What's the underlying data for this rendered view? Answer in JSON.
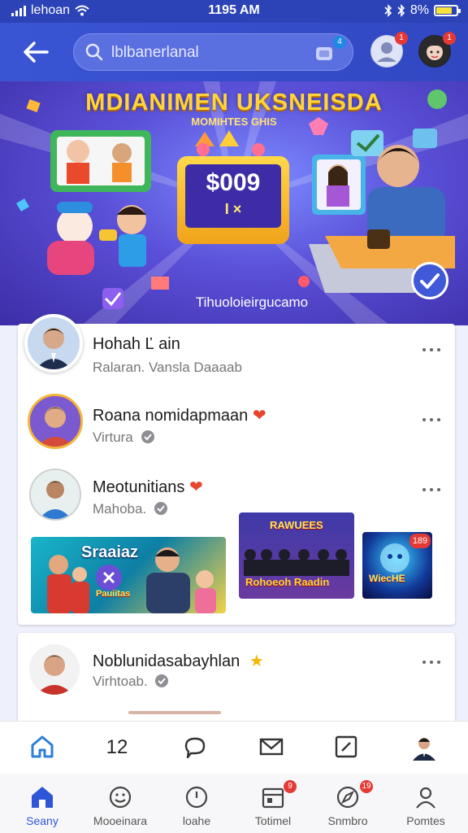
{
  "status": {
    "carrier": "lehoan",
    "time": "1195 AM",
    "battery": "8%",
    "battery_level": 0.8
  },
  "header": {
    "search_value": "lblbanerlanal",
    "camera_badge": "4",
    "contact_badge": "1",
    "profile_badge": "1"
  },
  "hero": {
    "title": "MDIANIMEN UKSNEISDA",
    "subtitle": "MOMIHTES GHIS",
    "tv_amount": "$009",
    "tv_line2": "I  ×",
    "caption": "Tihuoloieirgucamo"
  },
  "posts": [
    {
      "name": "Hohah Ľ ain",
      "sub": "Ralaran.  Vansla Daaaab",
      "emoji": ""
    },
    {
      "name": "Roana nomidapmaan",
      "sub": "Virtura",
      "emoji": "❤"
    },
    {
      "name": "Meotunitians",
      "sub": "Mahoba.",
      "emoji": "❤"
    },
    {
      "name": "Noblunidasabayhlan",
      "sub": "Virhtoab.",
      "emoji": "★"
    }
  ],
  "media": {
    "thumb1_label": "Sraaiaz",
    "thumb1_sub": "Pauiitas",
    "thumb2_top": "RAWUEES",
    "thumb2_label": "Rohoeoh Raadin",
    "thumb3_label": "WiecHE",
    "thumb3_badge": "189"
  },
  "toolbar": {
    "count": "12"
  },
  "tabs": [
    {
      "label": "Seany",
      "badge": ""
    },
    {
      "label": "Mooeinara",
      "badge": ""
    },
    {
      "label": "loahe",
      "badge": ""
    },
    {
      "label": "Totimel",
      "badge": "9"
    },
    {
      "label": "Snmbro",
      "badge": "19"
    },
    {
      "label": "Pomtes",
      "badge": ""
    }
  ],
  "colors": {
    "primary": "#3147c2",
    "accent": "#2f56d6",
    "badge": "#e53935",
    "hero_title": "#ffd43a"
  }
}
